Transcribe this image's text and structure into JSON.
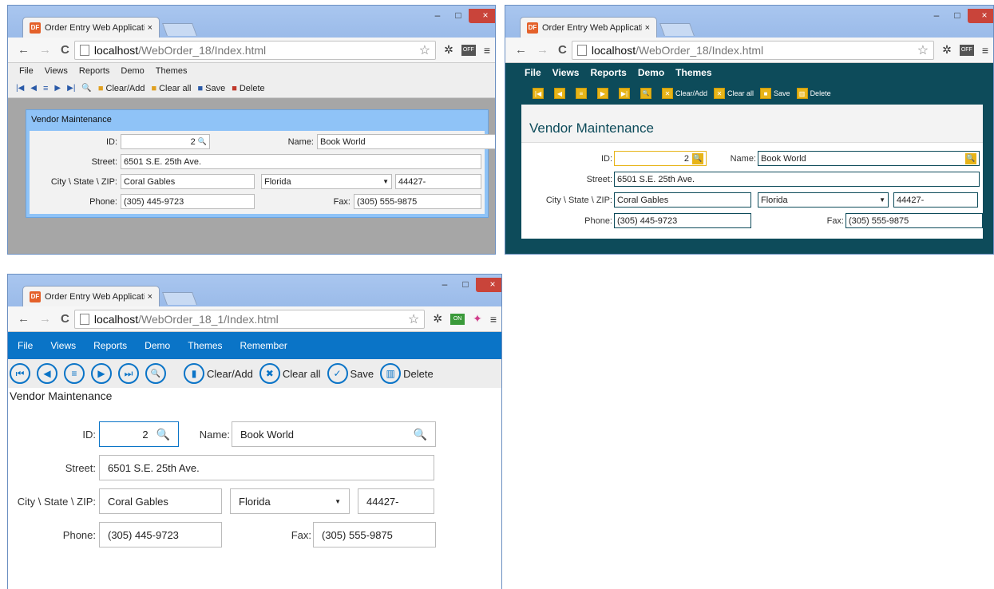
{
  "tab_title": "Order Entry Web Applicati",
  "tab_close": "×",
  "favicon": "DF",
  "window_controls": {
    "minimize": "–",
    "maximize": "□",
    "close": "×"
  },
  "nav": {
    "back": "←",
    "forward": "→",
    "reload": "C"
  },
  "icons": {
    "star": "☆",
    "gear": "✲",
    "ext_off": "OFF",
    "ext_on": "ON",
    "colorwheel": "✦",
    "menu": "≡",
    "search": "🔍"
  },
  "windows": [
    {
      "url_host": "localhost",
      "url_path": "/WebOrder_18/Index.html",
      "menu": [
        "File",
        "Views",
        "Reports",
        "Demo",
        "Themes"
      ],
      "nav_glyphs": [
        "|◀",
        "◀",
        "≡",
        "▶",
        "▶|",
        "🔍"
      ],
      "toolbar": {
        "clear_add": "Clear/Add",
        "clear_all": "Clear all",
        "save": "Save",
        "delete": "Delete"
      },
      "form_title": "Vendor Maintenance"
    },
    {
      "url_host": "localhost",
      "url_path": "/WebOrder_18/Index.html",
      "menu": [
        "File",
        "Views",
        "Reports",
        "Demo",
        "Themes"
      ],
      "nav_glyphs": [
        "|◀",
        "◀",
        "≡",
        "▶",
        "▶|",
        "🔍"
      ],
      "toolbar": {
        "clear_add": "Clear/Add",
        "clear_all": "Clear all",
        "save": "Save",
        "delete": "Delete"
      },
      "form_title": "Vendor Maintenance"
    },
    {
      "url_host": "localhost",
      "url_path": "/WebOrder_18_1/Index.html",
      "menu": [
        "File",
        "Views",
        "Reports",
        "Demo",
        "Themes",
        "Remember"
      ],
      "nav_glyphs": [
        "⏮",
        "◀",
        "≡",
        "▶",
        "⏭",
        "🔍"
      ],
      "toolbar": {
        "clear_add": "Clear/Add",
        "clear_all": "Clear all",
        "save": "Save",
        "delete": "Delete"
      },
      "form_title": "Vendor Maintenance"
    }
  ],
  "labels": {
    "id": "ID:",
    "name": "Name:",
    "street": "Street:",
    "city_state_zip": "City \\ State \\ ZIP:",
    "phone": "Phone:",
    "fax": "Fax:"
  },
  "record": {
    "id": "2",
    "name": "Book World",
    "street": "6501 S.E. 25th Ave.",
    "city": "Coral Gables",
    "state": "Florida",
    "zip": "44427-",
    "phone": "(305) 445-9723",
    "fax": "(305) 555-9875"
  },
  "dropdown_arrow": "▼",
  "colors": {
    "theme1_panel": "#8fc3f7",
    "theme2_bg": "#0d4b5a",
    "theme2_accent": "#e7b418",
    "theme3_accent": "#0a74c7"
  }
}
